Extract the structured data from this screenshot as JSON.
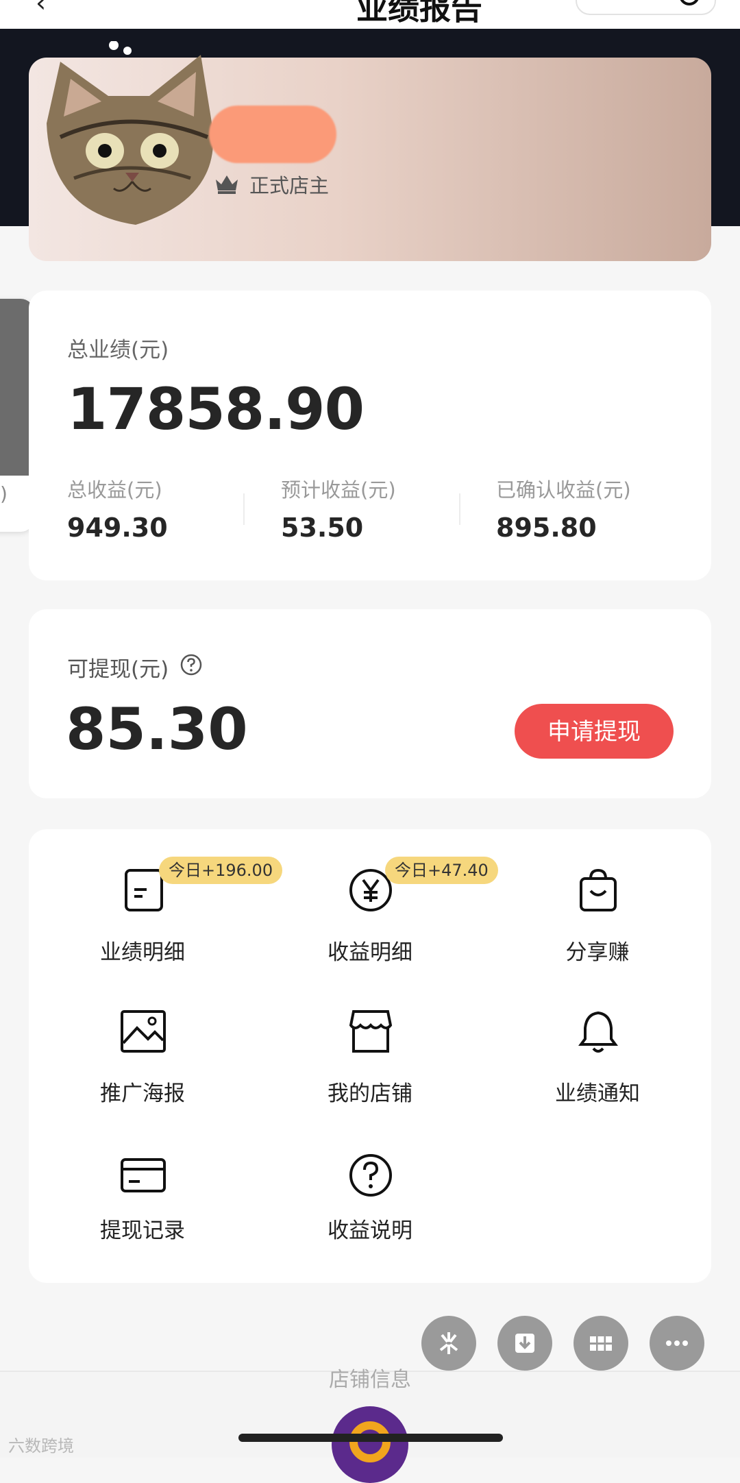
{
  "nav": {
    "title": "业绩报告",
    "back_icon": "back-arrow-icon"
  },
  "profile": {
    "level_label": "正式店主"
  },
  "performance": {
    "total_label": "总业绩(元)",
    "total_value": "17858.90",
    "stats": [
      {
        "label": "总收益(元)",
        "value": "949.30"
      },
      {
        "label": "预计收益(元)",
        "value": "53.50"
      },
      {
        "label": "已确认收益(元)",
        "value": "895.80"
      }
    ]
  },
  "side_tab": {
    "text": ")"
  },
  "withdraw": {
    "label": "可提现(元)",
    "value": "85.30",
    "button_label": "申请提现"
  },
  "menu": {
    "items": [
      {
        "label": "业绩明细",
        "icon": "document-icon",
        "badge": "今日+196.00"
      },
      {
        "label": "收益明细",
        "icon": "yen-coin-icon",
        "badge": "今日+47.40"
      },
      {
        "label": "分享赚",
        "icon": "shopping-bag-icon"
      },
      {
        "label": "推广海报",
        "icon": "image-icon"
      },
      {
        "label": "我的店铺",
        "icon": "store-icon"
      },
      {
        "label": "业绩通知",
        "icon": "bell-icon"
      },
      {
        "label": "提现记录",
        "icon": "card-icon"
      },
      {
        "label": "收益说明",
        "icon": "help-icon"
      }
    ]
  },
  "fabs": [
    "sparkle-icon",
    "download-icon",
    "grid-icon",
    "more-icon"
  ],
  "bottom": {
    "shop_info": "店铺信息",
    "watermark": "六数跨境"
  },
  "colors": {
    "accent": "#ef4f4f",
    "badge": "#f6d77d",
    "dark_header": "#131620"
  }
}
